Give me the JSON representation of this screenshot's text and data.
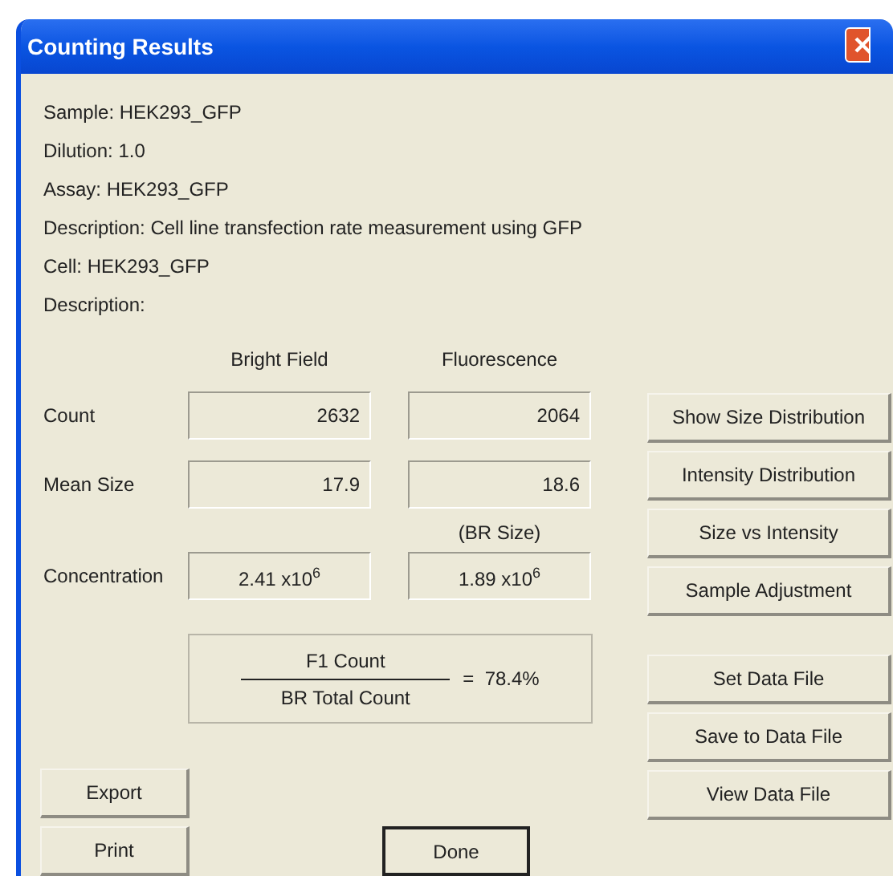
{
  "window": {
    "title": "Counting Results"
  },
  "info_lines": [
    "Sample: HEK293_GFP",
    "Dilution: 1.0",
    "Assay: HEK293_GFP",
    "Description: Cell line transfection rate measurement using GFP",
    "Cell: HEK293_GFP",
    "Description:"
  ],
  "columns": [
    "Bright Field",
    "Fluorescence"
  ],
  "rows": [
    {
      "label": "Count",
      "bright_field": "2632",
      "fluorescence": "2064"
    },
    {
      "label": "Mean Size",
      "bright_field": "17.9",
      "fluorescence": "18.6",
      "note": "(BR Size)"
    },
    {
      "label": "Concentration",
      "bright_field": "2.41 x10$^{6}$",
      "fluorescence": "1.89 x10$^{6}$"
    }
  ],
  "ratio": {
    "numerator": "F1 Count",
    "denominator": "BR Total Count",
    "result": "=  78.4%"
  },
  "analysis_buttons": [
    "Show Size Distribution",
    "Intensity Distribution",
    "Size vs Intensity",
    "Sample Adjustment"
  ],
  "data_file_buttons": [
    "Set Data File",
    "Save to Data File",
    "View Data File"
  ],
  "bottom_buttons": [
    {
      "label": "Export",
      "default": false
    },
    {
      "label": "Print",
      "default": false
    },
    {
      "label": "Done",
      "default": true
    }
  ]
}
